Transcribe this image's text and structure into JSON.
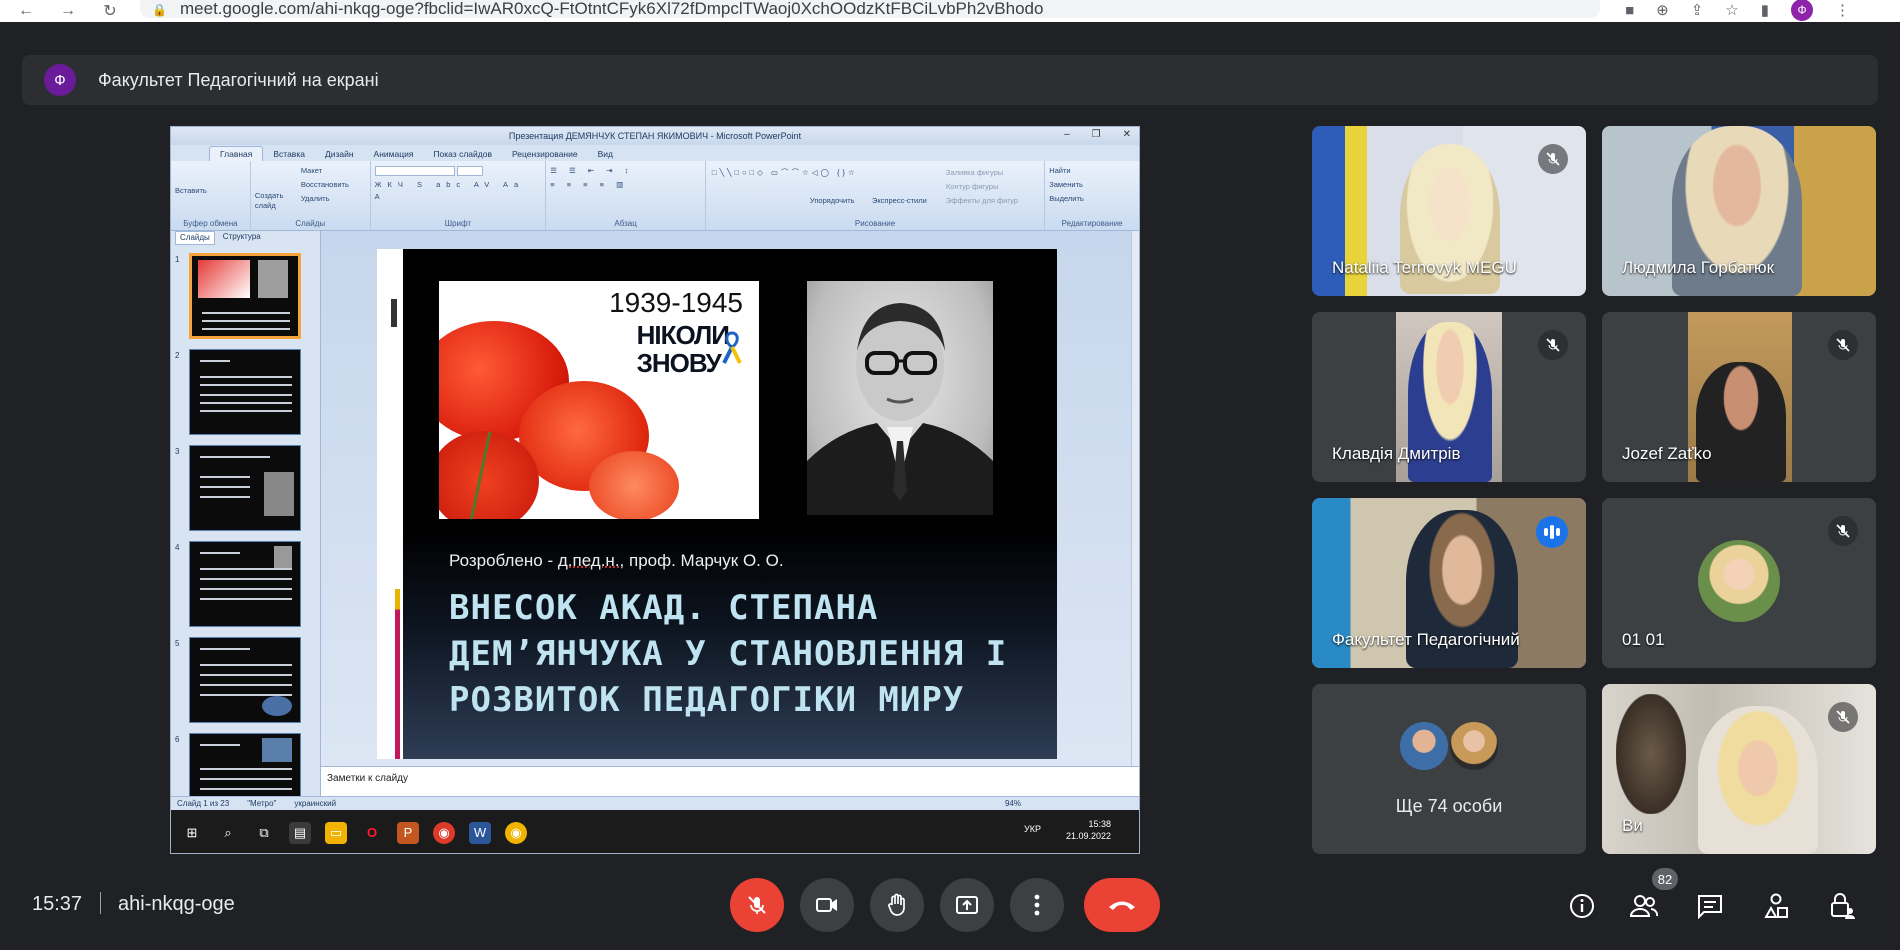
{
  "browser": {
    "url": "meet.google.com/ahi-nkqg-oge?fbclid=IwAR0xcQ-FtOtntCFyk6Xl72fDmpclTWaoj0XchOOdzKtFBCiLvbPh2vBhodo",
    "profile_initial": "Ф"
  },
  "banner": {
    "avatar_initial": "Ф",
    "text": "Факультет Педагогічний на екрані"
  },
  "ppt": {
    "window_title": "Презентация ДЕМЯНЧУК СТЕПАН ЯКИМОВИЧ - Microsoft PowerPoint",
    "tabs": [
      "Главная",
      "Вставка",
      "Дизайн",
      "Анимация",
      "Показ слайдов",
      "Рецензирование",
      "Вид"
    ],
    "ribbon_groups": [
      "Буфер обмена",
      "Слайды",
      "Шрифт",
      "Абзац",
      "Рисование",
      "Редактирование"
    ],
    "ribbon_buttons": {
      "paste": "Вставить",
      "create_slide": "Создать слайд",
      "layout": "Макет",
      "restore": "Восстановить",
      "delete": "Удалить",
      "arrange": "Упорядочить",
      "express_styles": "Экспресс-стили",
      "shape_fill": "Заливка фигуры",
      "shape_outline": "Контур фигуры",
      "shape_effects": "Эффекты для фигур",
      "find": "Найти",
      "replace": "Заменить",
      "select": "Выделить"
    },
    "pane_tabs": [
      "Слайды",
      "Структура"
    ],
    "thumbnail_numbers": [
      "1",
      "2",
      "3",
      "4",
      "5",
      "6"
    ],
    "slide": {
      "poster_year": "1939-1945",
      "poster_line1": "НІКОЛИ",
      "poster_line2": "ЗНОВУ",
      "credit_prefix": "Розроблено - ",
      "credit_degree": "д.пед.н.",
      "credit_rest": ", проф. Марчук О. О.",
      "title": "ВНЕСОК АКАД. СТЕПАНА ДЕМ’ЯНЧУКА У СТАНОВЛЕННЯ І РОЗВИТОК ПЕДАГОГІКИ МИРУ"
    },
    "notes_placeholder": "Заметки к слайду",
    "status": {
      "slide_of": "Слайд 1 из 23",
      "theme": "\"Метро\"",
      "lang": "украинский",
      "zoom": "94%"
    },
    "taskbar": {
      "lang": "УКР",
      "time": "15:38",
      "date": "21.09.2022"
    }
  },
  "participants": [
    {
      "name": "Nataliia Ternovyk MEGU",
      "muted": true
    },
    {
      "name": "Людмила Горбатюк",
      "muted": false
    },
    {
      "name": "Клавдія Дмитрів",
      "muted": true
    },
    {
      "name": "Jozef Zaťko",
      "muted": true
    },
    {
      "name": "Факультет Педагогічний",
      "speaking": true
    },
    {
      "name": "01 01",
      "muted": true
    },
    {
      "name": "Ще 74 особи"
    },
    {
      "name": "Ви",
      "muted": true
    }
  ],
  "footer": {
    "time": "15:37",
    "meeting_code": "ahi-nkqg-oge",
    "participants_badge": "82"
  },
  "colors": {
    "background": "#202124",
    "tile": "#3c4043",
    "danger": "#ea4335",
    "accent": "#8ab4f8",
    "speaking": "#1a73e8"
  }
}
